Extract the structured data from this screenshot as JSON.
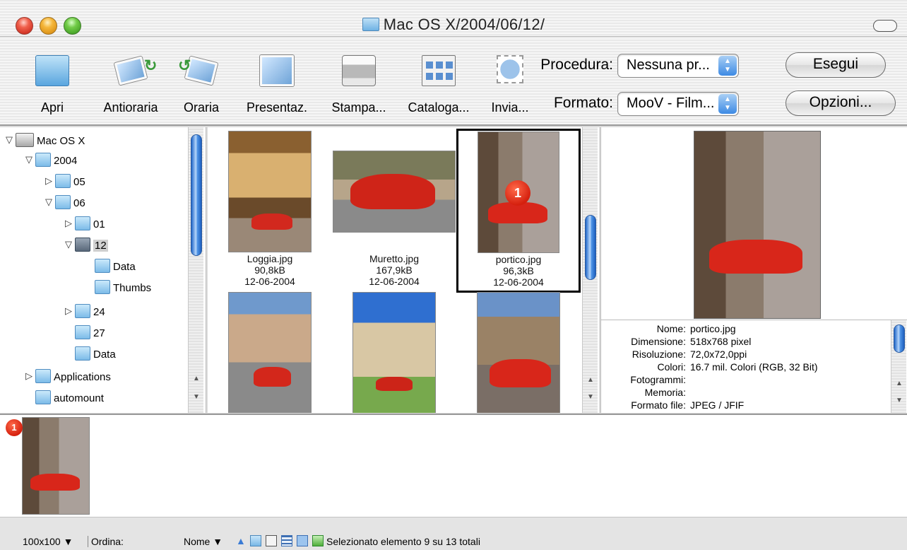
{
  "window": {
    "title": "Mac OS X/2004/06/12/"
  },
  "toolbar": {
    "buttons": [
      {
        "label": "Apri",
        "icon": "folder-icon"
      },
      {
        "label": "Antioraria",
        "icon": "rotate-left-icon"
      },
      {
        "label": "Oraria",
        "icon": "rotate-right-icon"
      },
      {
        "label": "Presentaz.",
        "icon": "slideshow-icon"
      },
      {
        "label": "Stampa...",
        "icon": "printer-icon"
      },
      {
        "label": "Cataloga...",
        "icon": "catalog-icon"
      },
      {
        "label": "Invia...",
        "icon": "send-stamp-icon"
      }
    ],
    "procedura_label": "Procedura:",
    "procedura_value": "Nessuna pr...",
    "formato_label": "Formato:",
    "formato_value": "MooV - Film...",
    "esegui_label": "Esegui",
    "opzioni_label": "Opzioni..."
  },
  "tree": {
    "items": [
      {
        "label": "Mac OS X",
        "expanded": true
      },
      {
        "label": "2004",
        "expanded": true
      },
      {
        "label": "05",
        "expanded": false
      },
      {
        "label": "06",
        "expanded": true
      },
      {
        "label": "01",
        "expanded": false
      },
      {
        "label": "12",
        "expanded": true,
        "selected": true
      },
      {
        "label": "Data"
      },
      {
        "label": "Thumbs"
      },
      {
        "label": "24",
        "expanded": false
      },
      {
        "label": "27"
      },
      {
        "label": "Data"
      },
      {
        "label": "Applications",
        "expanded": false
      },
      {
        "label": "automount"
      }
    ]
  },
  "thumbnails": [
    {
      "name": "Loggia.jpg",
      "size": "90,8kB",
      "date": "12-06-2004"
    },
    {
      "name": "Muretto.jpg",
      "size": "167,9kB",
      "date": "12-06-2004"
    },
    {
      "name": "portico.jpg",
      "size": "96,3kB",
      "date": "12-06-2004",
      "selected": true,
      "badge": "1"
    }
  ],
  "info": {
    "rows": [
      {
        "key": "Nome:",
        "value": "portico.jpg"
      },
      {
        "key": "Dimensione:",
        "value": "518x768 pixel"
      },
      {
        "key": "Risoluzione:",
        "value": "72,0x72,0ppi"
      },
      {
        "key": "Colori:",
        "value": "16.7 mil. Colori (RGB, 32 Bit)"
      },
      {
        "key": "Fotogrammi:",
        "value": ""
      },
      {
        "key": "Memoria:",
        "value": ""
      },
      {
        "key": "Formato file:",
        "value": "JPEG / JFIF"
      }
    ]
  },
  "tray": {
    "badge": "1"
  },
  "statusbar": {
    "thumb_size": "100x100",
    "sort_label": "Ordina:",
    "sort_value": "Nome",
    "status_text": "Selezionato elemento 9 su 13 totali"
  }
}
